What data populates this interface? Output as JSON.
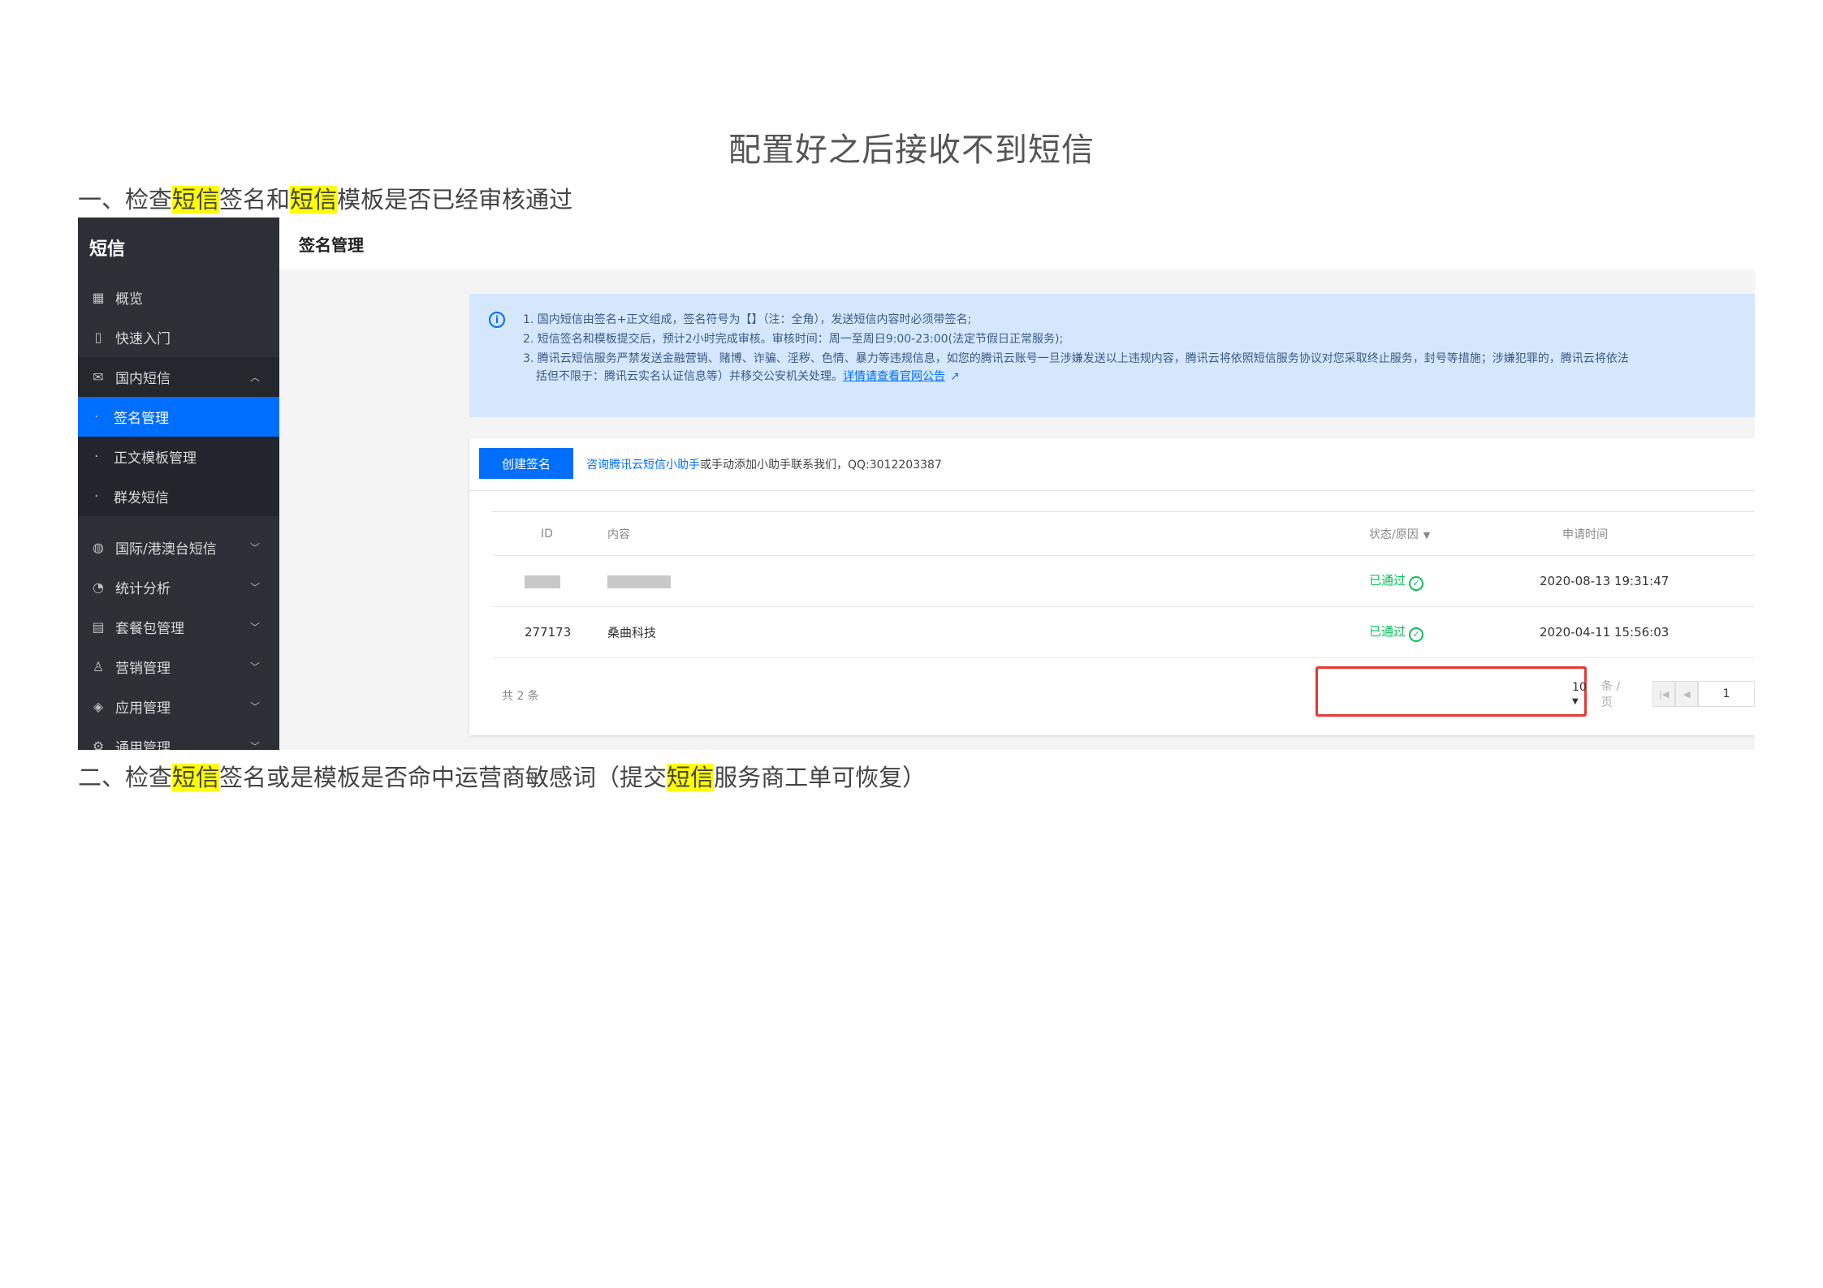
{
  "document": {
    "title": "配置好之后接收不到短信",
    "h1": {
      "prefix": "一、检查",
      "hl1": "短信",
      "mid": "签名和",
      "hl2": "短信",
      "suffix": "模板是否已经审核通过"
    },
    "h2": {
      "prefix": "二、检查",
      "hl1": "短信",
      "mid": "签名或是模板是否命中运营商敏感词（提交",
      "hl2": "短信",
      "suffix": "服务商工单可恢复）"
    },
    "highlight_color": "#ffff00"
  },
  "sidebar": {
    "title": "短信",
    "items": [
      {
        "label": "概览",
        "icon": "grid-icon"
      },
      {
        "label": "快速入门",
        "icon": "book-icon"
      },
      {
        "label": "国内短信",
        "icon": "mail-icon",
        "expanded": true
      },
      {
        "label": "国际/港澳台短信",
        "icon": "globe-icon"
      },
      {
        "label": "统计分析",
        "icon": "pie-chart-icon"
      },
      {
        "label": "套餐包管理",
        "icon": "package-icon"
      },
      {
        "label": "营销管理",
        "icon": "user-group-icon"
      },
      {
        "label": "应用管理",
        "icon": "layers-icon"
      },
      {
        "label": "通用管理",
        "icon": "settings-icon"
      }
    ],
    "subitems": [
      {
        "label": "签名管理",
        "active": true
      },
      {
        "label": "正文模板管理"
      },
      {
        "label": "群发短信"
      }
    ],
    "bg_color": "#2c2f36",
    "active_color": "#006eff"
  },
  "topbar": {
    "title": "签名管理"
  },
  "notice": {
    "line1": "1. 国内短信由签名+正文组成，签名符号为【】（注：全角），发送短信内容时必须带签名;",
    "line2": "2. 短信签名和模板提交后，预计2小时完成审核。审核时间：周一至周日9:00-23:00(法定节假日正常服务);",
    "line3": "3. 腾讯云短信服务严禁发送金融营销、赌博、诈骗、淫秽、色情、暴力等违规信息，如您的腾讯云账号一旦涉嫌发送以上违规内容，腾讯云将依照短信服务协议对您采取终止服务，封号等措施；涉嫌犯罪的，腾讯云将依法",
    "line4_prefix": "括但不限于：腾讯云实名认证信息等）并移交公安机关处理。",
    "line4_link": "详情请查看官网公告"
  },
  "toolbar": {
    "create_label": "创建签名",
    "consult_link": "咨询腾讯云短信小助手",
    "consult_text": "或手动添加小助手联系我们，QQ:3012203387"
  },
  "table": {
    "headers": {
      "id": "ID",
      "content": "内容",
      "status": "状态/原因",
      "time": "申请时间"
    },
    "rows": [
      {
        "id": "",
        "content": "",
        "status": "已通过",
        "time": "2020-08-13 19:31:47",
        "redacted": true
      },
      {
        "id": "277173",
        "content": "桑曲科技",
        "status": "已通过",
        "time": "2020-04-11 15:56:03",
        "redacted": false
      }
    ],
    "total": "共 2 条"
  },
  "pager": {
    "page_size": "10",
    "unit": "条 / 页",
    "page": "1"
  }
}
